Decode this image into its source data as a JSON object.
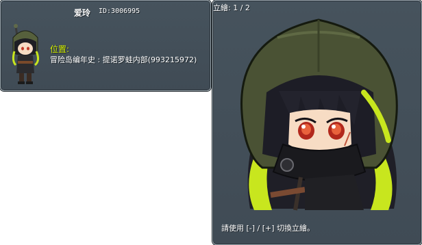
{
  "character": {
    "name": "爱玲",
    "id_text": "ID:3006995"
  },
  "location": {
    "label": "位置:",
    "value": "冒险岛编年史 : 提诺罗蛙内部(993215972)"
  },
  "portrait": {
    "header": "立繪: 1 / 2",
    "hint": "請使用 [-] / [+] 切換立繪。"
  },
  "colors": {
    "panel_bg": "#46535d",
    "label_accent": "#d4f000",
    "hair_highlight": "#c8e61e",
    "hood": "#4a5234"
  }
}
